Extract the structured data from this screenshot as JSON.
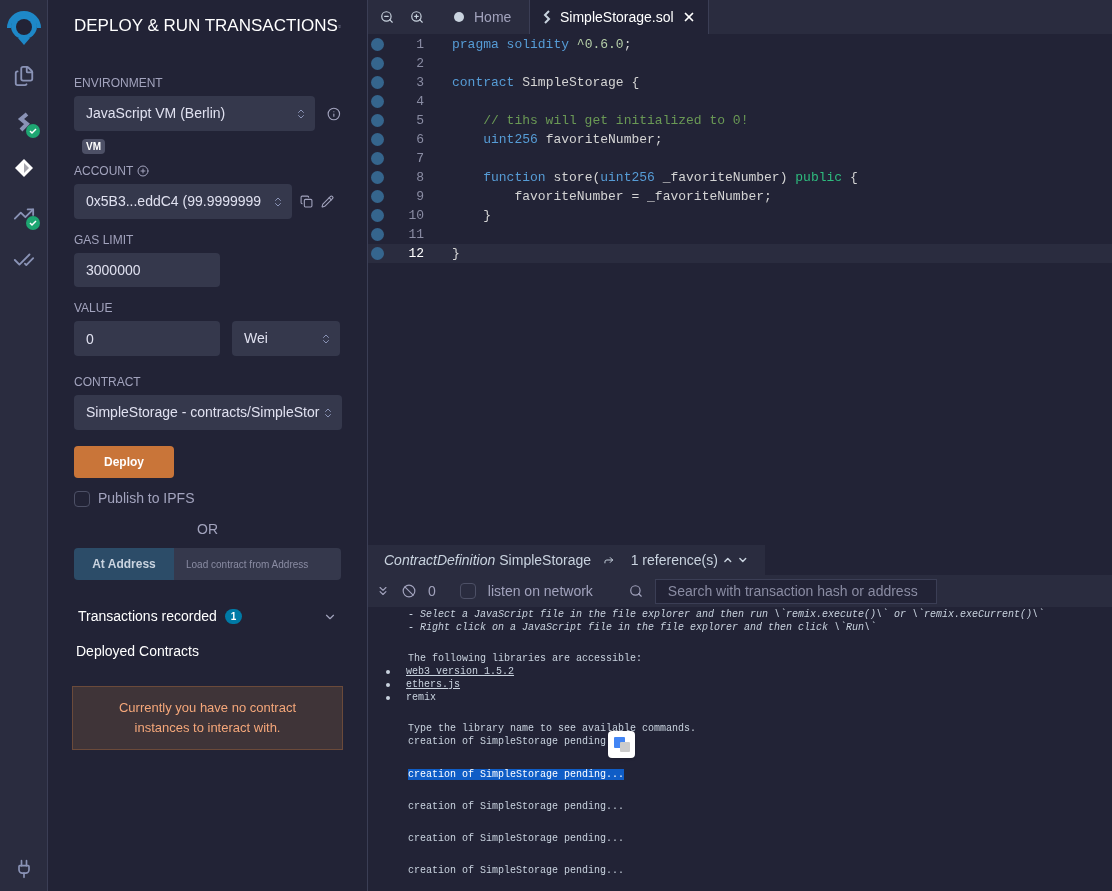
{
  "icon_bar": {
    "items": [
      {
        "kind": "files",
        "selected": false,
        "checked": false
      },
      {
        "kind": "compiler",
        "selected": false,
        "checked": true
      },
      {
        "kind": "deploy",
        "selected": true,
        "checked": false
      },
      {
        "kind": "analysis",
        "selected": false,
        "checked": true
      },
      {
        "kind": "tests",
        "selected": false,
        "checked": false
      }
    ]
  },
  "panel": {
    "title": "DEPLOY & RUN TRANSACTIONS",
    "environment": {
      "label": "ENVIRONMENT",
      "value": "JavaScript VM (Berlin)",
      "badge": "VM"
    },
    "account": {
      "label": "ACCOUNT",
      "value": "0x5B3...eddC4 (99.9999999"
    },
    "gas_limit": {
      "label": "GAS LIMIT",
      "value": "3000000"
    },
    "value": {
      "label": "VALUE",
      "amount": "0",
      "unit": "Wei"
    },
    "contract": {
      "label": "CONTRACT",
      "value": "SimpleStorage - contracts/SimpleStor"
    },
    "deploy_button": "Deploy",
    "publish": {
      "label": "Publish to IPFS",
      "checked": false
    },
    "or": "OR",
    "at_address": {
      "button": "At Address",
      "placeholder": "Load contract from Address"
    },
    "transactions": {
      "label": "Transactions recorded",
      "count": "1"
    },
    "deployed": {
      "label": "Deployed Contracts",
      "notice": "Currently you have no contract instances to interact with."
    }
  },
  "editor": {
    "tabs": [
      {
        "label": "Home",
        "kind": "home",
        "selected": false
      },
      {
        "label": "SimpleStorage.sol",
        "kind": "file",
        "selected": true
      }
    ],
    "lines": [
      {
        "number": "1",
        "current": false,
        "tokens": [
          {
            "kind": "keyword",
            "text": "pragma solidity"
          },
          {
            "kind": "number",
            "text": " ^0.6.0"
          },
          {
            "kind": "plain",
            "text": ";"
          }
        ]
      },
      {
        "number": "2",
        "current": false
      },
      {
        "number": "3",
        "current": false,
        "tokens": [
          {
            "kind": "keyword",
            "text": "contract"
          },
          {
            "kind": "plain",
            "text": " SimpleStorage {"
          }
        ]
      },
      {
        "number": "4",
        "current": false
      },
      {
        "number": "5",
        "current": false,
        "tokens": [
          {
            "kind": "comment",
            "text": "    // tihs will get initialized to 0!"
          }
        ]
      },
      {
        "number": "6",
        "current": false,
        "tokens": [
          {
            "kind": "keyword",
            "text": "    uint256"
          },
          {
            "kind": "plain",
            "text": " favoriteNumber;"
          }
        ]
      },
      {
        "number": "7",
        "current": false
      },
      {
        "number": "8",
        "current": false,
        "tokens": [
          {
            "kind": "keyword",
            "text": "    function"
          },
          {
            "kind": "plain",
            "text": " store("
          },
          {
            "kind": "keyword",
            "text": "uint256"
          },
          {
            "kind": "plain",
            "text": " _favoriteNumber) "
          },
          {
            "kind": "modifier",
            "text": "public"
          },
          {
            "kind": "plain",
            "text": " {"
          }
        ]
      },
      {
        "number": "9",
        "current": false,
        "tokens": [
          {
            "kind": "plain",
            "text": "        favoriteNumber = _favoriteNumber;"
          }
        ]
      },
      {
        "number": "10",
        "current": false,
        "tokens": [
          {
            "kind": "plain",
            "text": "    }"
          }
        ]
      },
      {
        "number": "11",
        "current": false
      },
      {
        "number": "12",
        "current": true,
        "tokens": [
          {
            "kind": "plain",
            "text": "}"
          }
        ]
      }
    ]
  },
  "definition_bar": {
    "kind_label": "ContractDefinition",
    "name": "SimpleStorage",
    "references": "1 reference(s)"
  },
  "terminal": {
    "count": "0",
    "listen": {
      "label": "listen on network",
      "checked": false
    },
    "search_placeholder": "Search with transaction hash or address",
    "lines": [
      {
        "kind": "hint",
        "text": "- Select a JavaScript file in the file explorer and then run \\`remix.execute()\\` or \\`remix.exeCurrent()\\`"
      },
      {
        "kind": "hint",
        "text": "- Right click on a JavaScript file in the file explorer and then click \\`Run\\`"
      },
      {
        "kind": "gap"
      },
      {
        "kind": "text",
        "text": "The following libraries are accessible:"
      },
      {
        "kind": "link-item",
        "text": "web3 version 1.5.2"
      },
      {
        "kind": "link-item",
        "text": "ethers.js"
      },
      {
        "kind": "item",
        "text": "remix"
      },
      {
        "kind": "gap"
      },
      {
        "kind": "text",
        "text": "Type the library name to see available commands."
      },
      {
        "kind": "text",
        "text": "creation of SimpleStorage pending"
      },
      {
        "kind": "selected",
        "text": "creation of SimpleStorage pending..."
      },
      {
        "kind": "text",
        "text": "creation of SimpleStorage pending..."
      },
      {
        "kind": "text",
        "text": "creation of SimpleStorage pending..."
      },
      {
        "kind": "text",
        "text": "creation of SimpleStorage pending..."
      }
    ]
  }
}
